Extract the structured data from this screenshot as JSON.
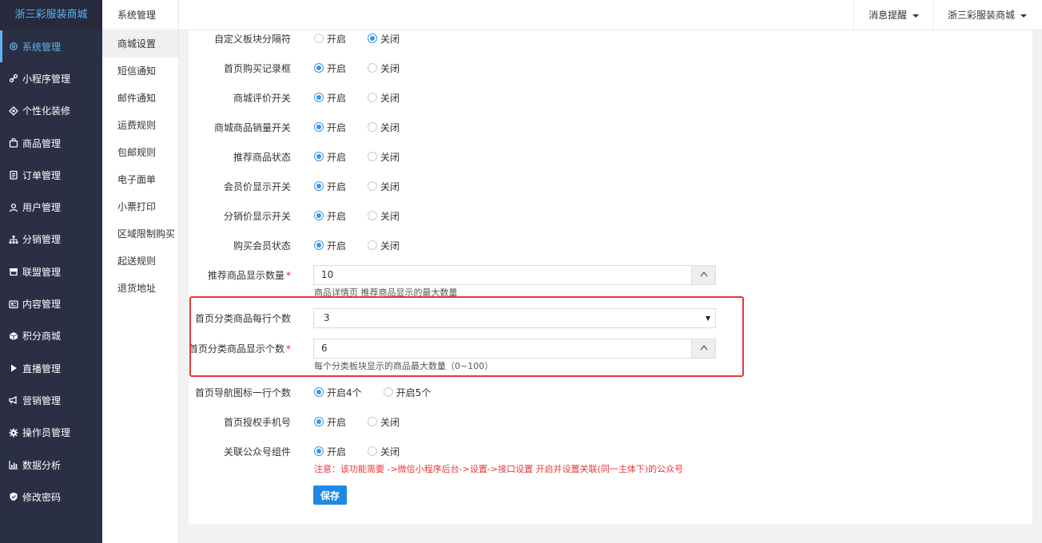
{
  "brand": "浙三彩服装商城",
  "nav": [
    {
      "label": "系统管理",
      "icon": "gear-icon",
      "active": true
    },
    {
      "label": "小程序管理",
      "icon": "link-icon"
    },
    {
      "label": "个性化装修",
      "icon": "diamond-icon"
    },
    {
      "label": "商品管理",
      "icon": "bag-icon"
    },
    {
      "label": "订单管理",
      "icon": "clipboard-icon"
    },
    {
      "label": "用户管理",
      "icon": "user-icon"
    },
    {
      "label": "分销管理",
      "icon": "sitemap-icon"
    },
    {
      "label": "联盟管理",
      "icon": "store-icon"
    },
    {
      "label": "内容管理",
      "icon": "news-icon"
    },
    {
      "label": "积分商城",
      "icon": "cube-icon"
    },
    {
      "label": "直播管理",
      "icon": "play-icon"
    },
    {
      "label": "营销管理",
      "icon": "megaphone-icon"
    },
    {
      "label": "操作员管理",
      "icon": "cog-icon"
    },
    {
      "label": "数据分析",
      "icon": "bar-chart-icon"
    },
    {
      "label": "修改密码",
      "icon": "shield-icon"
    }
  ],
  "subnav": {
    "title": "系统管理",
    "items": [
      "商城设置",
      "短信通知",
      "邮件通知",
      "运费规则",
      "包邮规则",
      "电子面单",
      "小票打印",
      "区域限制购买",
      "起送规则",
      "退货地址"
    ]
  },
  "topbar": {
    "notify": "消息提醒",
    "store": "浙三彩服装商城"
  },
  "form": {
    "on": "开启",
    "off": "关闭",
    "rows": [
      {
        "label": "自定义板块分隔符",
        "value": "off"
      },
      {
        "label": "首页购买记录框",
        "value": "on"
      },
      {
        "label": "商城评价开关",
        "value": "on"
      },
      {
        "label": "商城商品销量开关",
        "value": "on"
      },
      {
        "label": "推荐商品状态",
        "value": "on"
      },
      {
        "label": "会员价显示开关",
        "value": "on"
      },
      {
        "label": "分销价显示开关",
        "value": "on"
      },
      {
        "label": "购买会员状态",
        "value": "on"
      }
    ],
    "recommend_count": {
      "label": "推荐商品显示数量",
      "value": "10",
      "hint": "商品详情页 推荐商品显示的最大数量"
    },
    "per_row": {
      "label": "首页分类商品每行个数",
      "value": "3"
    },
    "category_count": {
      "label": "首页分类商品显示个数",
      "value": "6",
      "hint": "每个分类板块显示的商品最大数量（0~100）"
    },
    "nav_icons": {
      "label": "首页导航图标一行个数",
      "opt1": "开启4个",
      "opt2": "开启5个",
      "value": "opt1"
    },
    "auth_phone": {
      "label": "首页授权手机号",
      "value": "on"
    },
    "official_account": {
      "label": "关联公众号组件",
      "value": "on",
      "warning": "注意：该功能需要 ->微信小程序后台->设置->接口设置 开启并设置关联(同一主体下)的公众号"
    },
    "save": "保存"
  },
  "colors": {
    "sidebar": "#2b2f43",
    "accent": "#5eb4f2",
    "primary": "#1e88e5",
    "highlight": "#e53935",
    "warning": "#e4393c"
  }
}
